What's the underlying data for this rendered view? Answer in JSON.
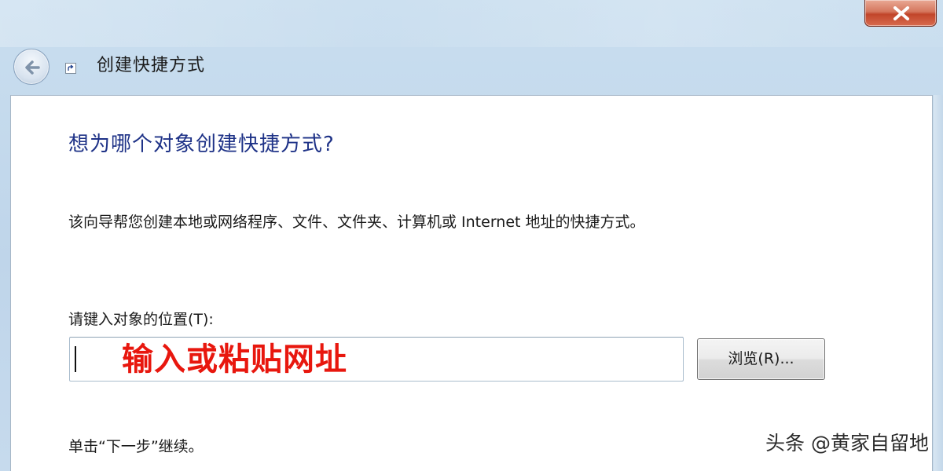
{
  "window": {
    "title": "创建快捷方式",
    "close_icon": "close-icon",
    "back_icon": "back-arrow-icon",
    "shortcut_icon": "shortcut-arrow-icon"
  },
  "wizard": {
    "heading": "想为哪个对象创建快捷方式?",
    "description": "该向导帮您创建本地或网络程序、文件、文件夹、计算机或 Internet 地址的快捷方式。",
    "location_label": "请键入对象的位置(T):",
    "location_value": "",
    "location_hint": "输入或粘贴网址",
    "browse_label": "浏览(R)...",
    "footer": "单击“下一步”继续。"
  },
  "watermark": "头条 @黄家自留地",
  "colors": {
    "heading": "#1e3287",
    "hint": "#e8170e",
    "close_button": "#c1452a"
  }
}
